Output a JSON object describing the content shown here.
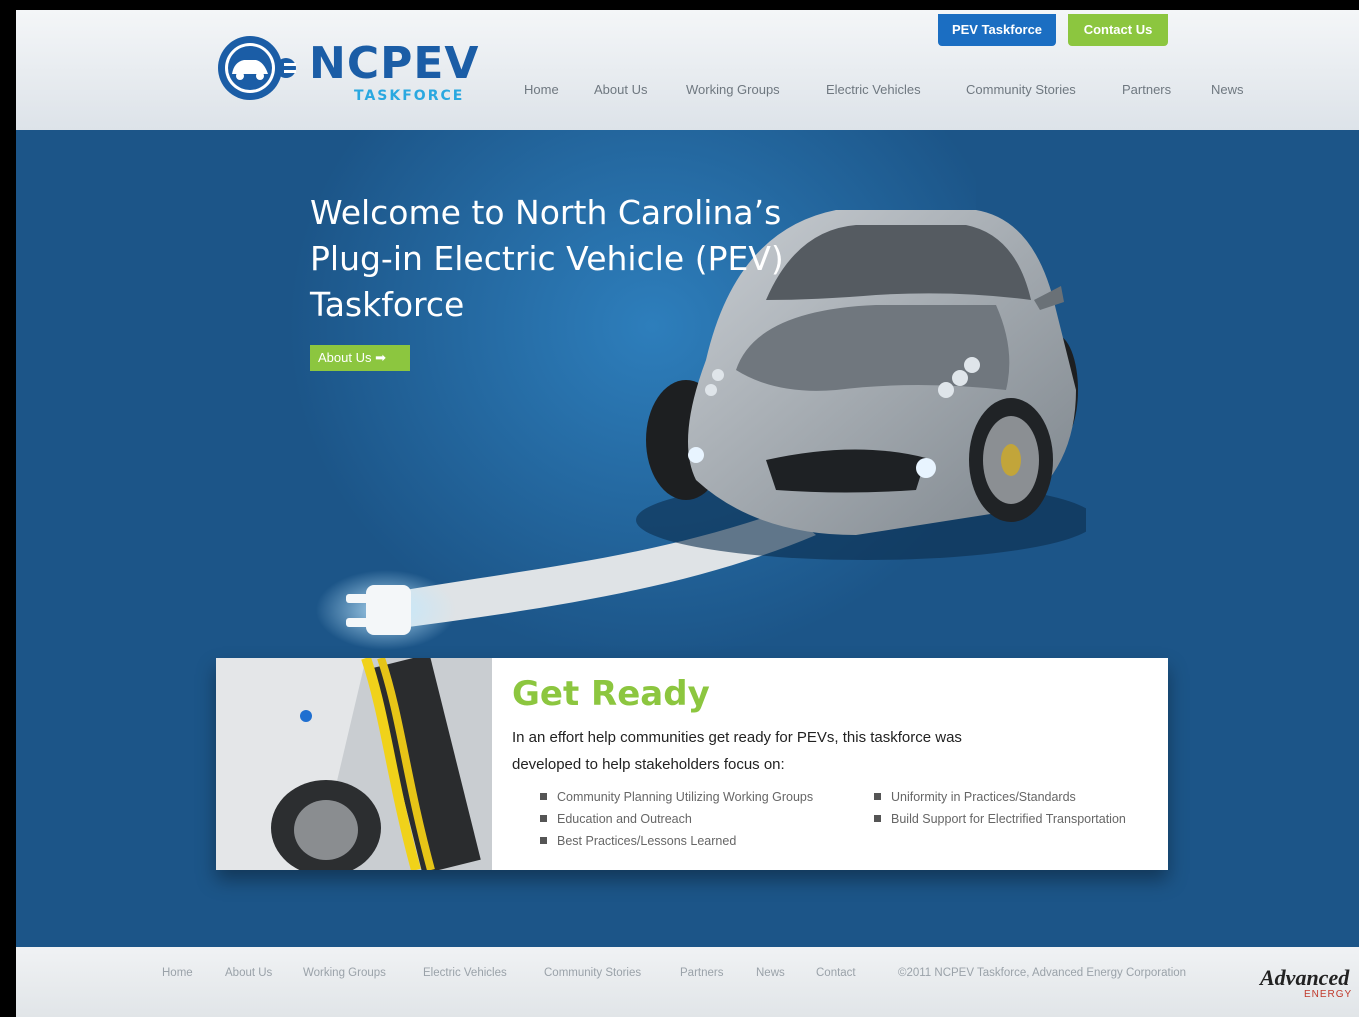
{
  "header": {
    "logo_main": "NCPEV",
    "logo_sub": "TASKFORCE",
    "top_buttons": {
      "pev": "PEV Taskforce",
      "contact": "Contact Us"
    },
    "nav": [
      "Home",
      "About Us",
      "Working Groups",
      "Electric Vehicles",
      "Community Stories",
      "Partners",
      "News"
    ]
  },
  "hero": {
    "title": "Welcome to North Carolina’s Plug-in Electric Vehicle (PEV) Taskforce",
    "about_button": "About Us ➡"
  },
  "get_ready": {
    "title": "Get Ready",
    "intro": "In an effort help communities get ready for PEVs, this taskforce was developed to help stakeholders focus on:",
    "bullets_left": [
      "Community Planning Utilizing Working Groups",
      "Education and Outreach",
      "Best Practices/Lessons Learned"
    ],
    "bullets_right": [
      "Uniformity in Practices/Standards",
      "Build Support for Electrified Transportation"
    ]
  },
  "footer": {
    "links": [
      "Home",
      "About Us",
      "Working Groups",
      "Electric Vehicles",
      "Community Stories",
      "Partners",
      "News",
      "Contact"
    ],
    "copyright": "©2011 NCPEV Taskforce, Advanced Energy Corporation",
    "ae_logo_main": "Advanced",
    "ae_logo_sub": "ENERGY"
  },
  "colors": {
    "background_blue": "#1c5588",
    "accent_green": "#8cc63f",
    "button_blue": "#1b6ec2"
  }
}
